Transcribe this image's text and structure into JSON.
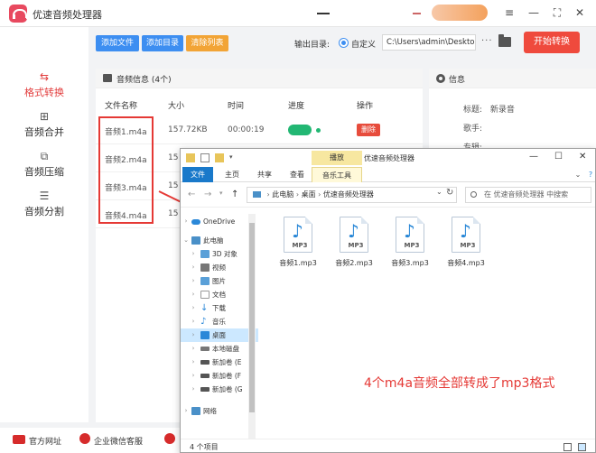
{
  "app": {
    "title": "优速音频处理器"
  },
  "sidebar": {
    "items": [
      {
        "label": "格式转换",
        "icon": "convert-icon",
        "active": true
      },
      {
        "label": "音频合并",
        "icon": "merge-icon",
        "active": false
      },
      {
        "label": "音频压缩",
        "icon": "compress-icon",
        "active": false
      },
      {
        "label": "音频分割",
        "icon": "split-icon",
        "active": false
      }
    ]
  },
  "toolbar": {
    "add_file": "添加文件",
    "add_folder": "添加目录",
    "clear_list": "清除列表",
    "output_dir_label": "输出目录:",
    "custom_label": "自定义",
    "output_path": "C:\\Users\\admin\\Deskto",
    "more": "···",
    "start_button": "开始转换"
  },
  "file_panel": {
    "header": "音频信息 (4个)",
    "columns": [
      "文件名称",
      "大小",
      "时间",
      "进度",
      "操作"
    ],
    "rows": [
      {
        "name": "音频1.m4a",
        "size": "157.72KB",
        "time": "00:00:19",
        "action": "删除"
      },
      {
        "name": "音频2.m4a",
        "size": "15"
      },
      {
        "name": "音频3.m4a",
        "size": "15"
      },
      {
        "name": "音频4.m4a",
        "size": "15"
      }
    ]
  },
  "info_panel": {
    "header": "信息",
    "fields": [
      {
        "label": "标题:",
        "value": "新录音"
      },
      {
        "label": "歌手:",
        "value": ""
      },
      {
        "label": "专辑:",
        "value": ""
      }
    ]
  },
  "bottom_bar": {
    "website": "官方网址",
    "wechat": "企业微信客服"
  },
  "explorer": {
    "play_tab": "播放",
    "window_title": "优速音频处理器",
    "tabs": [
      "文件",
      "主页",
      "共享",
      "查看",
      "音乐工具"
    ],
    "address_parts": [
      "此电脑",
      "桌面",
      "优速音频处理器"
    ],
    "search_placeholder": "在 优速音频处理器 中搜索",
    "tree": [
      {
        "label": "OneDrive",
        "color": "#2b88d8"
      },
      {
        "label": "此电脑",
        "color": "#4a90c8"
      },
      {
        "label": "3D 对象",
        "color": "#5aa0d8"
      },
      {
        "label": "视频",
        "color": "#777777"
      },
      {
        "label": "图片",
        "color": "#5aa0d8"
      },
      {
        "label": "文档",
        "color": "#999999"
      },
      {
        "label": "下载",
        "color": "#2b88d8"
      },
      {
        "label": "音乐",
        "color": "#2b88d8"
      },
      {
        "label": "桌面",
        "color": "#2b88d8"
      },
      {
        "label": "本地磁盘",
        "color": "#777777"
      },
      {
        "label": "新加卷 (E",
        "color": "#555555"
      },
      {
        "label": "新加卷 (F",
        "color": "#555555"
      },
      {
        "label": "新加卷 (G",
        "color": "#555555"
      },
      {
        "label": "网络",
        "color": "#4a90c8"
      }
    ],
    "files": [
      {
        "name": "音频1.mp3",
        "tag": "MP3"
      },
      {
        "name": "音频2.mp3",
        "tag": "MP3"
      },
      {
        "name": "音频3.mp3",
        "tag": "MP3"
      },
      {
        "name": "音频4.mp3",
        "tag": "MP3"
      }
    ],
    "annotation": "4个m4a音频全部转成了mp3格式",
    "status": "4 个项目"
  },
  "colors": {
    "accent_red": "#e23d3d",
    "blue_button": "#3d8ef1",
    "orange_button": "#f2a436",
    "progress_green": "#22b773"
  }
}
